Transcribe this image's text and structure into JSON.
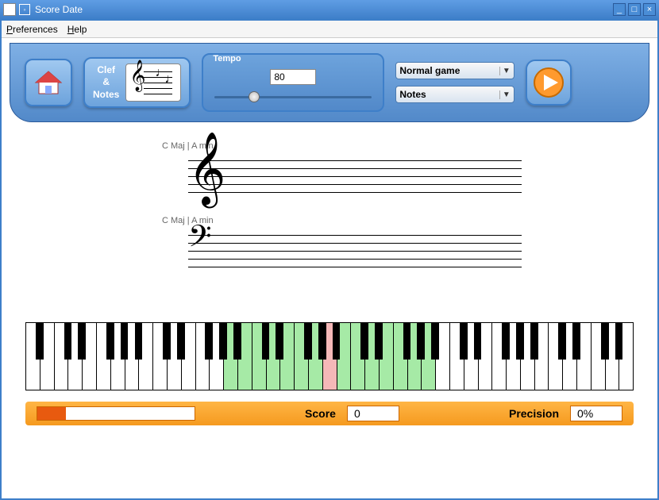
{
  "window": {
    "title": "Score Date"
  },
  "menu": {
    "preferences": "Preferences",
    "help": "Help"
  },
  "toolbar": {
    "home_icon": "home",
    "clef_label_1": "Clef",
    "clef_label_2": "&",
    "clef_label_3": "Notes",
    "tempo_label": "Tempo",
    "tempo_value": "80",
    "select_mode": "Normal game",
    "select_type": "Notes",
    "play_icon": "play"
  },
  "staves": {
    "treble_key": "C Maj | A min",
    "bass_key": "C Maj | A min"
  },
  "piano": {
    "highlighted_green_start": 14,
    "highlighted_green_end": 28,
    "highlighted_pink": 21
  },
  "status": {
    "progress_pct": 18,
    "score_label": "Score",
    "score_value": "0",
    "precision_label": "Precision",
    "precision_value": "0%"
  }
}
